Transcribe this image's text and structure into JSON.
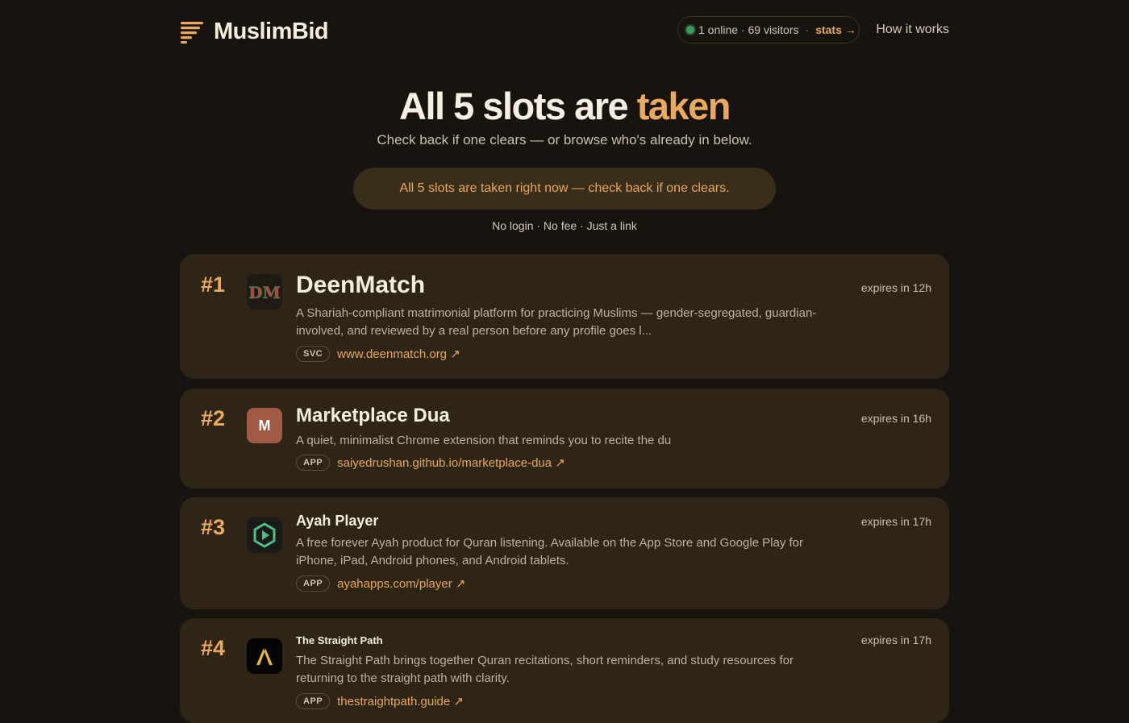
{
  "brand": {
    "name": "MuslimBid"
  },
  "stats": {
    "online": "1 online · 69 visitors",
    "separator": "·",
    "link": "stats →"
  },
  "nav": {
    "how_it_works": "How it works"
  },
  "hero": {
    "title_main": "All 5 slots are ",
    "title_accent": "taken",
    "subtitle": "Check back if one clears — or browse who's already in below.",
    "banner": "All 5 slots are taken right now — check back if one clears.",
    "footnote": "No login · No fee · Just a link"
  },
  "listings": [
    {
      "rank": "#1",
      "title": "DeenMatch",
      "avatar_text": "DM",
      "description": "A Shariah-compliant matrimonial platform for practicing Muslims — gender-segregated, guardian-involved, and reviewed by a real person before any profile goes l...",
      "tag": "SVC",
      "link": "www.deenmatch.org ↗",
      "expires": "expires in 12h"
    },
    {
      "rank": "#2",
      "title": "Marketplace Dua",
      "avatar_text": "M",
      "avatar_color": "#a35a44",
      "description": "A quiet, minimalist Chrome extension that reminds you to recite the du",
      "tag": "APP",
      "link": "saiyedrushan.github.io/marketplace-dua ↗",
      "expires": "expires in 16h"
    },
    {
      "rank": "#3",
      "title": "Ayah Player",
      "description": "A free forever Ayah product for Quran listening. Available on the App Store and Google Play for iPhone, iPad, Android phones, and Android tablets.",
      "tag": "APP",
      "link": "ayahapps.com/player ↗",
      "expires": "expires in 17h"
    },
    {
      "rank": "#4",
      "title": "The Straight Path",
      "description": "The Straight Path brings together Quran recitations, short reminders, and study resources for returning to the straight path with clarity.",
      "tag": "APP",
      "link": "thestraightpath.guide ↗",
      "expires": "expires in 17h"
    }
  ],
  "colors": {
    "background": "#17130e",
    "card": "#2f2516",
    "accent": "#eba95e",
    "online_dot": "#3e9a5a"
  }
}
